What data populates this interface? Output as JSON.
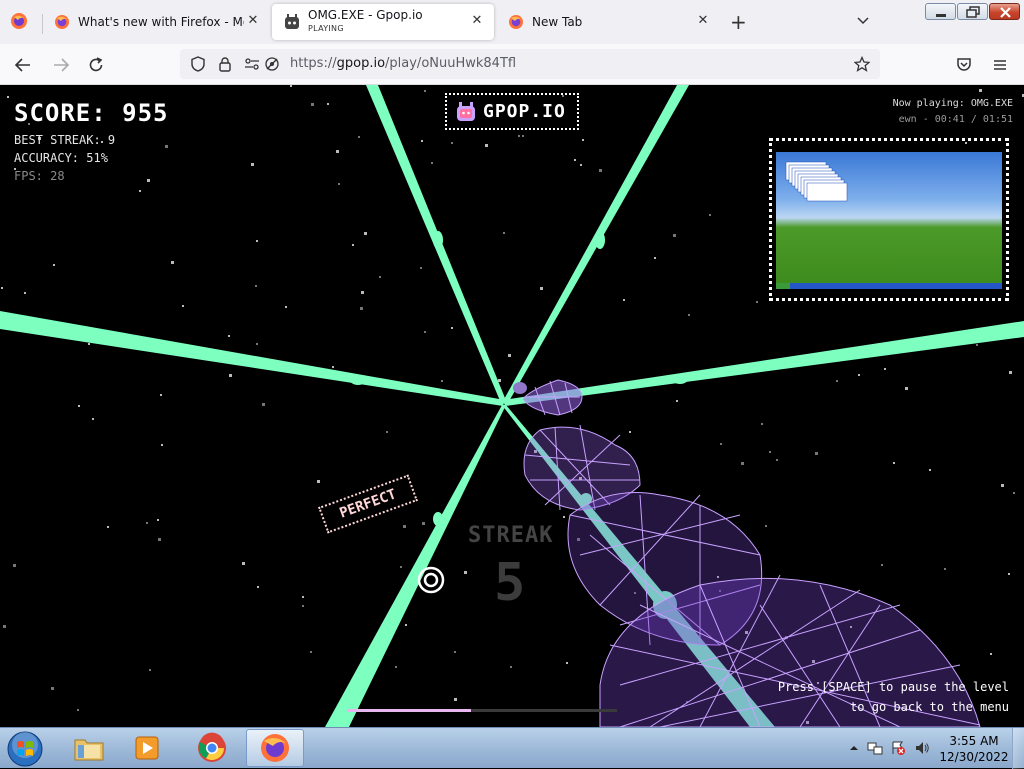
{
  "browser": {
    "tabs": [
      {
        "label": "What's new with Firefox - More",
        "sub": "",
        "active": false
      },
      {
        "label": "OMG.EXE - Gpop.io",
        "sub": "PLAYING",
        "active": true
      },
      {
        "label": "New Tab",
        "sub": "",
        "active": false
      }
    ],
    "url": {
      "prefix": "https://",
      "host": "gpop.io",
      "path": "/play/oNuuHwk84Tfl"
    }
  },
  "game": {
    "score_label": "SCORE: 955",
    "best_streak": "BEST STREAK: 9",
    "accuracy": "ACCURACY: 51%",
    "fps": "FPS: 28",
    "logo": "GPOP.IO",
    "now_playing": "Now playing: OMG.EXE",
    "time": "ewn - 00:41 / 01:51",
    "judgement": "PERFECT",
    "streak_label": "STREAK",
    "streak_value": "5",
    "hint_line1": "Press [SPACE] to pause the level",
    "hint_line2": "to go back to the menu",
    "progress": 0.46,
    "colors": {
      "beam": "#7dffc0",
      "note": "#b98cff",
      "bg": "#000000"
    }
  },
  "taskbar": {
    "apps": [
      "windows-explorer",
      "media-player",
      "chrome",
      "firefox"
    ],
    "clock_time": "3:55 AM",
    "clock_date": "12/30/2022"
  }
}
